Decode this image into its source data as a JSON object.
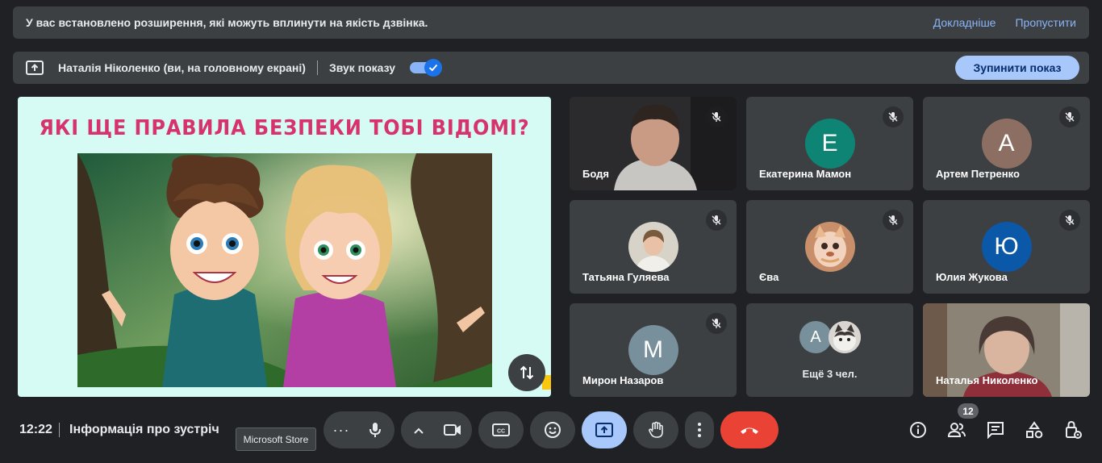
{
  "banner": {
    "message": "У вас встановлено розширення, які можуть вплинути на якість дзвінка.",
    "learn_more": "Докладніше",
    "skip": "Пропустити"
  },
  "sharebar": {
    "presenter": "Наталія Ніколенко (ви, на головному екрані)",
    "sound_label": "Звук показу",
    "sound_on": true,
    "stop_button": "Зупинити показ"
  },
  "presentation": {
    "slide_title": "ЯКІ ЩЕ ПРАВИЛА БЕЗПЕКИ  ТОБІ ВІДОМІ?"
  },
  "participants": [
    {
      "name": "Бодя",
      "type": "video",
      "muted": true
    },
    {
      "name": "Екатерина Мамон",
      "type": "initial",
      "initial": "Е",
      "color": "#0e8474",
      "muted": true
    },
    {
      "name": "Артем Петренко",
      "type": "initial",
      "initial": "А",
      "color": "#8d6e63",
      "muted": true
    },
    {
      "name": "Татьяна Гуляева",
      "type": "photo",
      "muted": true
    },
    {
      "name": "Єва",
      "type": "photo",
      "muted": true
    },
    {
      "name": "Юлия Жукова",
      "type": "initial",
      "initial": "Ю",
      "color": "#0b57a8",
      "muted": true
    },
    {
      "name": "Мирон Назаров",
      "type": "initial",
      "initial": "М",
      "color": "#78909c",
      "muted": true
    },
    {
      "name": "Наталья Николенко",
      "type": "video",
      "muted": false
    }
  ],
  "more_tile": {
    "initial": "А",
    "initial_color": "#78909c",
    "label": "Ещё 3 чел."
  },
  "bottombar": {
    "time": "12:22",
    "meeting_info": "Інформація про зустріч",
    "tooltip": "Microsoft Store",
    "people_count": "12"
  },
  "icons": {
    "more_options": "more-dots-icon",
    "mic": "microphone-icon",
    "camera": "camera-icon",
    "captions": "captions-icon",
    "emoji": "emoji-icon",
    "present": "present-screen-icon",
    "hand": "raise-hand-icon",
    "menu": "vertical-dots-icon",
    "end": "end-call-icon",
    "info": "info-icon",
    "people": "people-icon",
    "chat": "chat-icon",
    "activities": "activities-icon",
    "host": "host-controls-icon"
  },
  "colors": {
    "background": "#202124",
    "surface": "#3c4043",
    "accent": "#a8c7fa",
    "link": "#8ab4f8",
    "end_call": "#ea4335",
    "slide_title": "#d6336c"
  }
}
